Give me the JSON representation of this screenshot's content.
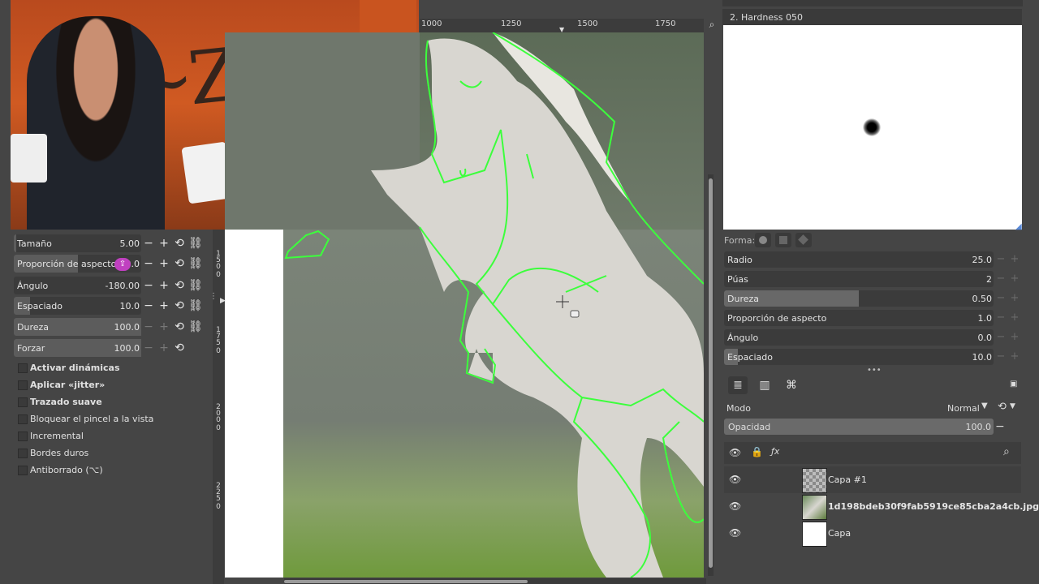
{
  "ruler_top": {
    "ticks": [
      "1000",
      "1250",
      "1500",
      "1750"
    ]
  },
  "ruler_left": {
    "numbers": [
      "1",
      "5",
      "0",
      "0",
      "1",
      "7",
      "5",
      "0",
      "2",
      "0",
      "0",
      "0",
      "2",
      "2",
      "5",
      "0"
    ]
  },
  "tool_options": {
    "sliders": [
      {
        "label": "Tamaño",
        "value": "5.00",
        "fill": 0.02
      },
      {
        "label": "Proporción de aspecto",
        "value": "0.0",
        "fill": 0.5
      },
      {
        "label": "Ángulo",
        "value": "-180.00",
        "fill": 0.0
      },
      {
        "label": "Espaciado",
        "value": "10.0",
        "fill": 0.13
      },
      {
        "label": "Dureza",
        "value": "100.0",
        "fill": 1.0
      },
      {
        "label": "Forzar",
        "value": "100.0",
        "fill": 1.0
      }
    ],
    "checkboxes": [
      {
        "label": "Activar dinámicas",
        "bold": true
      },
      {
        "label": "Aplicar «jitter»",
        "bold": true
      },
      {
        "label": "Trazado suave",
        "bold": true
      },
      {
        "label": "Bloquear el pincel a la vista",
        "bold": false
      },
      {
        "label": "Incremental",
        "bold": false
      },
      {
        "label": "Bordes duros",
        "bold": false
      },
      {
        "label": "Antiborrado  (⌥)",
        "bold": false
      }
    ]
  },
  "brush": {
    "title": "2. Hardness 050",
    "shape_label": "Forma:",
    "params": [
      {
        "label": "Radio",
        "value": "25.0",
        "fill": 0.0
      },
      {
        "label": "Púas",
        "value": "2",
        "fill": 0.0
      },
      {
        "label": "Dureza",
        "value": "0.50",
        "fill": 0.5
      },
      {
        "label": "Proporción de aspecto",
        "value": "1.0",
        "fill": 0.0
      },
      {
        "label": "Ángulo",
        "value": "0.0",
        "fill": 0.0
      },
      {
        "label": "Espaciado",
        "value": "10.0",
        "fill": 0.05
      }
    ]
  },
  "layers_panel": {
    "mode_label": "Modo",
    "mode_value": "Normal",
    "opacity_label": "Opacidad",
    "opacity_value": "100.0",
    "layers": [
      {
        "name": "Capa #1",
        "bold": false,
        "thumb": "transparent"
      },
      {
        "name": "1d198bdeb30f9fab5919ce85cba2a4cb.jpg",
        "bold": true,
        "thumb": "photo"
      },
      {
        "name": "Capa",
        "bold": false,
        "thumb": "white"
      }
    ]
  },
  "colors": {
    "selection": "#3cff3c",
    "panel": "#454545",
    "accent_badge": "#c040c0"
  }
}
